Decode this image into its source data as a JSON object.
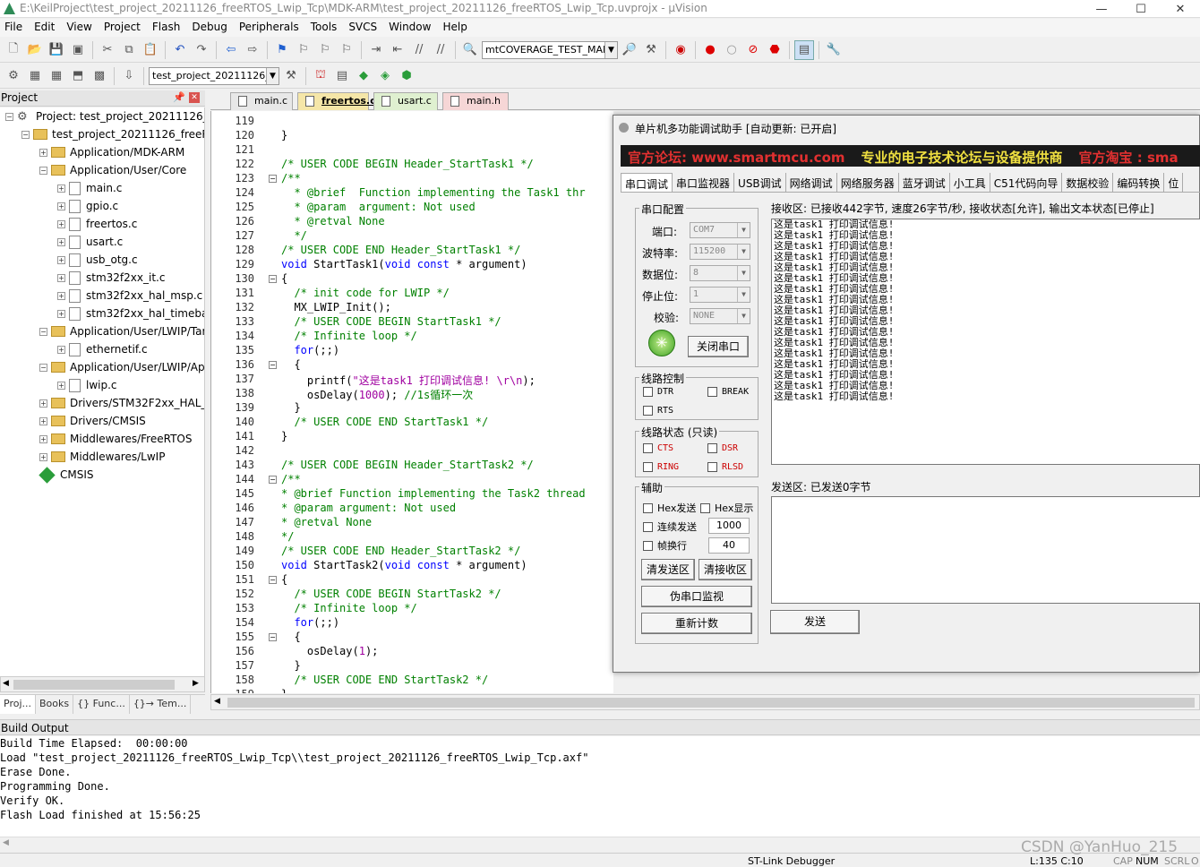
{
  "window": {
    "title": "E:\\KeilProject\\test_project_20211126_freeRTOS_Lwip_Tcp\\MDK-ARM\\test_project_20211126_freeRTOS_Lwip_Tcp.uvprojx - µVision"
  },
  "menu": [
    "File",
    "Edit",
    "View",
    "Project",
    "Flash",
    "Debug",
    "Peripherals",
    "Tools",
    "SVCS",
    "Window",
    "Help"
  ],
  "toolbar1": {
    "combo": "mtCOVERAGE_TEST_MAR"
  },
  "toolbar2": {
    "target": "test_project_20211126_fr"
  },
  "project_panel": {
    "title": "Project",
    "tree": [
      {
        "label": "Project: test_project_20211126_free",
        "type": "proj"
      },
      {
        "label": "test_project_20211126_freeRTOS",
        "type": "target"
      },
      {
        "label": "Application/MDK-ARM",
        "type": "folder"
      },
      {
        "label": "Application/User/Core",
        "type": "folder"
      },
      {
        "label": "main.c",
        "type": "file"
      },
      {
        "label": "gpio.c",
        "type": "file"
      },
      {
        "label": "freertos.c",
        "type": "file"
      },
      {
        "label": "usart.c",
        "type": "file"
      },
      {
        "label": "usb_otg.c",
        "type": "file"
      },
      {
        "label": "stm32f2xx_it.c",
        "type": "file"
      },
      {
        "label": "stm32f2xx_hal_msp.c",
        "type": "file"
      },
      {
        "label": "stm32f2xx_hal_timebas",
        "type": "file"
      },
      {
        "label": "Application/User/LWIP/Targ",
        "type": "folder"
      },
      {
        "label": "ethernetif.c",
        "type": "file"
      },
      {
        "label": "Application/User/LWIP/App",
        "type": "folder"
      },
      {
        "label": "lwip.c",
        "type": "file"
      },
      {
        "label": "Drivers/STM32F2xx_HAL_Dr",
        "type": "folder"
      },
      {
        "label": "Drivers/CMSIS",
        "type": "folder"
      },
      {
        "label": "Middlewares/FreeRTOS",
        "type": "folder"
      },
      {
        "label": "Middlewares/LwIP",
        "type": "folder"
      },
      {
        "label": "CMSIS",
        "type": "gem"
      }
    ],
    "tabs": [
      "Proj...",
      "Books",
      "{} Func...",
      "{}→ Tem..."
    ]
  },
  "editor": {
    "tabs": [
      "main.c",
      "freertos.c",
      "usart.c",
      "main.h"
    ],
    "lines": [
      {
        "n": "119",
        "text": ""
      },
      {
        "n": "120",
        "text": "}"
      },
      {
        "n": "121",
        "text": ""
      },
      {
        "n": "122",
        "text": "/* USER CODE BEGIN Header_StartTask1 */"
      },
      {
        "n": "123",
        "text": "/**"
      },
      {
        "n": "124",
        "text": "  * @brief  Function implementing the Task1 thr"
      },
      {
        "n": "125",
        "text": "  * @param  argument: Not used"
      },
      {
        "n": "126",
        "text": "  * @retval None"
      },
      {
        "n": "127",
        "text": "  */"
      },
      {
        "n": "128",
        "text": "/* USER CODE END Header_StartTask1 */"
      },
      {
        "n": "129",
        "text": "void StartTask1(void const * argument)"
      },
      {
        "n": "130",
        "text": "{"
      },
      {
        "n": "131",
        "text": "  /* init code for LWIP */"
      },
      {
        "n": "132",
        "text": "  MX_LWIP_Init();"
      },
      {
        "n": "133",
        "text": "  /* USER CODE BEGIN StartTask1 */"
      },
      {
        "n": "134",
        "text": "  /* Infinite loop */"
      },
      {
        "n": "135",
        "text": "  for(;;)"
      },
      {
        "n": "136",
        "text": "  {"
      },
      {
        "n": "137",
        "text": "    printf(\"这是task1 打印调试信息! \\r\\n\");"
      },
      {
        "n": "138",
        "text": "    osDelay(1000); //1s循环一次"
      },
      {
        "n": "139",
        "text": "  }"
      },
      {
        "n": "140",
        "text": "  /* USER CODE END StartTask1 */"
      },
      {
        "n": "141",
        "text": "}"
      },
      {
        "n": "142",
        "text": ""
      },
      {
        "n": "143",
        "text": "/* USER CODE BEGIN Header_StartTask2 */"
      },
      {
        "n": "144",
        "text": "/**"
      },
      {
        "n": "145",
        "text": "* @brief Function implementing the Task2 thread"
      },
      {
        "n": "146",
        "text": "* @param argument: Not used"
      },
      {
        "n": "147",
        "text": "* @retval None"
      },
      {
        "n": "148",
        "text": "*/"
      },
      {
        "n": "149",
        "text": "/* USER CODE END Header_StartTask2 */"
      },
      {
        "n": "150",
        "text": "void StartTask2(void const * argument)"
      },
      {
        "n": "151",
        "text": "{"
      },
      {
        "n": "152",
        "text": "  /* USER CODE BEGIN StartTask2 */"
      },
      {
        "n": "153",
        "text": "  /* Infinite loop */"
      },
      {
        "n": "154",
        "text": "  for(;;)"
      },
      {
        "n": "155",
        "text": "  {"
      },
      {
        "n": "156",
        "text": "    osDelay(1);"
      },
      {
        "n": "157",
        "text": "  }"
      },
      {
        "n": "158",
        "text": "  /* USER CODE END StartTask2 */"
      },
      {
        "n": "159",
        "text": "}"
      }
    ]
  },
  "serial": {
    "title": "单片机多功能调试助手 [自动更新: 已开启]",
    "banner": [
      "官方论坛: www.smartmcu.com",
      "专业的电子技术论坛与设备提供商",
      "官方淘宝 : sma"
    ],
    "tabs": [
      "串口调试",
      "串口监视器",
      "USB调试",
      "网络调试",
      "网络服务器",
      "蓝牙调试",
      "小工具",
      "C51代码向导",
      "数据校验",
      "编码转换",
      "位"
    ],
    "config": {
      "group": "串口配置",
      "port_label": "端口:",
      "port": "COM7",
      "baud_label": "波特率:",
      "baud": "115200",
      "data_label": "数据位:",
      "data": "8",
      "stop_label": "停止位:",
      "stop": "1",
      "parity_label": "校验:",
      "parity": "NONE",
      "close_btn": "关闭串口"
    },
    "line_ctrl": {
      "group": "线路控制",
      "dtr": "DTR",
      "brk": "BREAK",
      "rts": "RTS"
    },
    "line_state": {
      "group": "线路状态 (只读)",
      "cts": "CTS",
      "dsr": "DSR",
      "ring": "RING",
      "rlsd": "RLSD"
    },
    "aux": {
      "group": "辅助",
      "hex_send": "Hex发送",
      "hex_show": "Hex显示",
      "cont_send": "连续发送",
      "cont_val": "1000",
      "frame": "帧换行",
      "frame_val": "40",
      "clear_send": "清发送区",
      "clear_recv": "清接收区",
      "monitor": "伪串口监视",
      "recount": "重新计数"
    },
    "recv_title": "接收区: 已接收442字节, 速度26字节/秒, 接收状态[允许], 输出文本状态[已停止]",
    "recv_line": "这是task1 打印调试信息!",
    "recv_count": 17,
    "send_title": "发送区: 已发送0字节",
    "send_btn": "发送"
  },
  "build": {
    "title": "Build Output",
    "lines": [
      "Build Time Elapsed:  00:00:00",
      "Load \"test_project_20211126_freeRTOS_Lwip_Tcp\\\\test_project_20211126_freeRTOS_Lwip_Tcp.axf\"",
      "Erase Done.",
      "Programming Done.",
      "Verify OK.",
      "Flash Load finished at 15:56:25"
    ]
  },
  "status": {
    "debugger": "ST-Link Debugger",
    "pos": "L:135 C:10",
    "caps": "CAP",
    "num": "NUM",
    "scrl": "SCRL",
    "ovr": "O"
  },
  "watermark": "CSDN @YanHuo_215"
}
